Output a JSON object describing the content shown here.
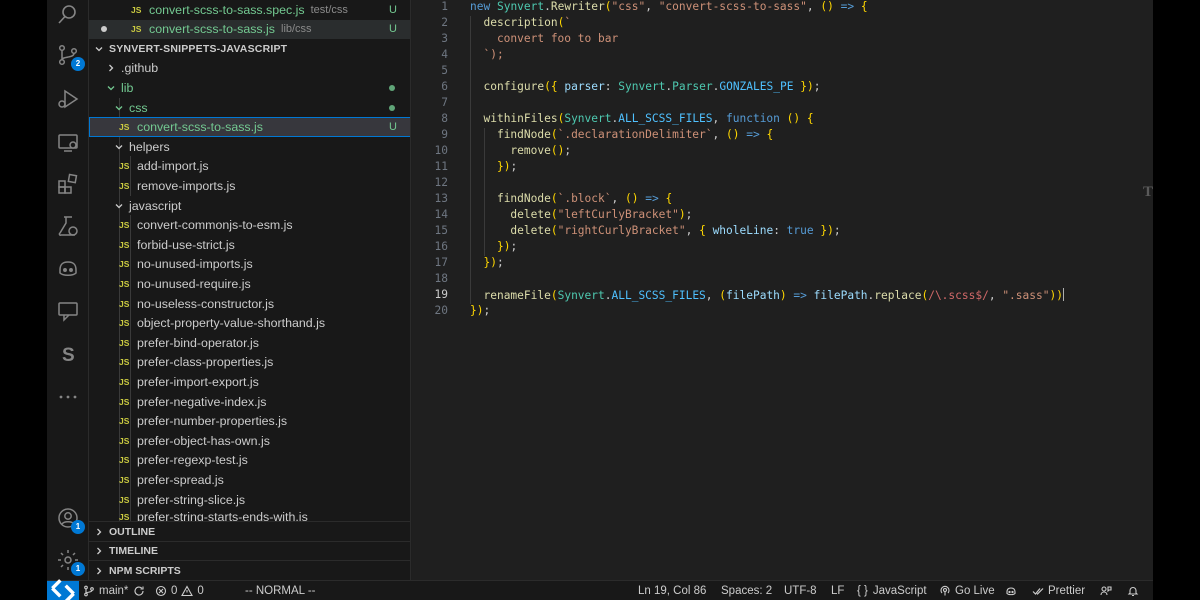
{
  "activity_bar": {
    "scm_badge": "2",
    "account_badge": "1",
    "settings_badge": "1",
    "items": [
      "search-icon",
      "source-control-icon",
      "run-debug-icon",
      "remote-explorer-icon",
      "extensions-icon",
      "testing-icon",
      "copilot-icon",
      "chat-icon",
      "synvert-icon",
      "more-icon",
      "account-icon",
      "manage-gear-icon"
    ]
  },
  "explorer": {
    "open_files": [
      {
        "name": "convert-scss-to-sass.spec.js",
        "path": "test/css",
        "status": "U"
      },
      {
        "name": "convert-scss-to-sass.js",
        "path": "lib/css",
        "status": "U"
      }
    ],
    "folder_name": "SYNVERT-SNIPPETS-JAVASCRIPT",
    "tree": [
      {
        "label": ".github",
        "type": "folder",
        "expanded": false
      },
      {
        "label": "lib",
        "type": "folder",
        "expanded": true
      },
      {
        "label": "css",
        "type": "folder",
        "expanded": true
      },
      {
        "label": "convert-scss-to-sass.js",
        "type": "file",
        "status": "U"
      },
      {
        "label": "helpers",
        "type": "folder",
        "expanded": true
      },
      {
        "label": "add-import.js",
        "type": "file"
      },
      {
        "label": "remove-imports.js",
        "type": "file"
      },
      {
        "label": "javascript",
        "type": "folder",
        "expanded": true
      },
      {
        "label": "convert-commonjs-to-esm.js",
        "type": "file"
      },
      {
        "label": "forbid-use-strict.js",
        "type": "file"
      },
      {
        "label": "no-unused-imports.js",
        "type": "file"
      },
      {
        "label": "no-unused-require.js",
        "type": "file"
      },
      {
        "label": "no-useless-constructor.js",
        "type": "file"
      },
      {
        "label": "object-property-value-shorthand.js",
        "type": "file"
      },
      {
        "label": "prefer-bind-operator.js",
        "type": "file"
      },
      {
        "label": "prefer-class-properties.js",
        "type": "file"
      },
      {
        "label": "prefer-import-export.js",
        "type": "file"
      },
      {
        "label": "prefer-negative-index.js",
        "type": "file"
      },
      {
        "label": "prefer-number-properties.js",
        "type": "file"
      },
      {
        "label": "prefer-object-has-own.js",
        "type": "file"
      },
      {
        "label": "prefer-regexp-test.js",
        "type": "file"
      },
      {
        "label": "prefer-spread.js",
        "type": "file"
      },
      {
        "label": "prefer-string-slice.js",
        "type": "file"
      },
      {
        "label": "prefer-string-starts-ends-with.js",
        "type": "file"
      }
    ],
    "file_badge": "JS",
    "sections": [
      "OUTLINE",
      "TIMELINE",
      "NPM SCRIPTS"
    ]
  },
  "editor": {
    "current_line": "19",
    "lines": [
      {
        "n": "1",
        "text": "new Synvert.Rewriter(\"css\", \"convert-scss-to-sass\", () => {"
      },
      {
        "n": "2",
        "text": "  description(`"
      },
      {
        "n": "3",
        "text": "    convert foo to bar"
      },
      {
        "n": "4",
        "text": "  `);"
      },
      {
        "n": "5",
        "text": ""
      },
      {
        "n": "6",
        "text": "  configure({ parser: Synvert.Parser.GONZALES_PE });"
      },
      {
        "n": "7",
        "text": ""
      },
      {
        "n": "8",
        "text": "  withinFiles(Synvert.ALL_SCSS_FILES, function () {"
      },
      {
        "n": "9",
        "text": "    findNode(`.declarationDelimiter`, () => {"
      },
      {
        "n": "10",
        "text": "      remove();"
      },
      {
        "n": "11",
        "text": "    });"
      },
      {
        "n": "12",
        "text": ""
      },
      {
        "n": "13",
        "text": "    findNode(`.block`, () => {"
      },
      {
        "n": "14",
        "text": "      delete(\"leftCurlyBracket\");"
      },
      {
        "n": "15",
        "text": "      delete(\"rightCurlyBracket\", { wholeLine: true });"
      },
      {
        "n": "16",
        "text": "    });"
      },
      {
        "n": "17",
        "text": "  });"
      },
      {
        "n": "18",
        "text": ""
      },
      {
        "n": "19",
        "text": "  renameFile(Synvert.ALL_SCSS_FILES, (filePath) => filePath.replace(/\\.scss$/, \".sass\"))"
      },
      {
        "n": "20",
        "text": "});"
      }
    ],
    "right_glyph": "T"
  },
  "status_bar": {
    "branch": "main*",
    "errors": "0",
    "warnings": "0",
    "mode": "-- NORMAL --",
    "position": "Ln 19, Col 86",
    "spaces": "Spaces: 2",
    "encoding": "UTF-8",
    "eol": "LF",
    "language": "JavaScript",
    "language_icon": "{ }",
    "go_live": "Go Live",
    "prettier": "Prettier"
  }
}
